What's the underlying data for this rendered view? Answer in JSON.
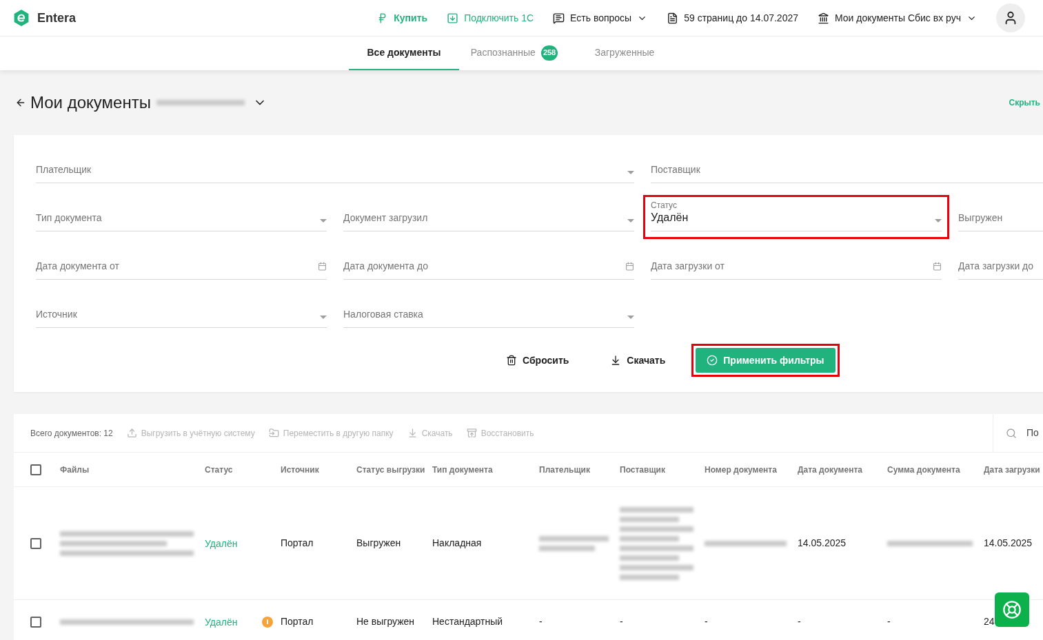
{
  "header": {
    "logo": "Entera",
    "nav": [
      {
        "label": "Купить",
        "kind": "buy",
        "accent": true,
        "dropdown": false
      },
      {
        "label": "Подключить 1С",
        "kind": "connect",
        "accent": true,
        "dropdown": false
      },
      {
        "label": "Есть вопросы",
        "kind": "help",
        "accent": false,
        "dropdown": true
      },
      {
        "label": "59 страниц до 14.07.2027",
        "kind": "pages",
        "accent": false,
        "dropdown": false
      },
      {
        "label": "Мои документы Сбис вх руч",
        "kind": "org",
        "accent": false,
        "dropdown": true
      }
    ]
  },
  "tabs": [
    {
      "label": "Все документы",
      "selected": true
    },
    {
      "label": "Распознанные",
      "selected": false,
      "badge": "258"
    },
    {
      "label": "Загруженные",
      "selected": false
    }
  ],
  "page": {
    "title": "Мои документы",
    "hide_link": "Скрыть"
  },
  "filters": {
    "rows": [
      [
        {
          "label": "Плательщик",
          "kind": "select",
          "highlighted": false
        },
        "",
        {
          "label": "Поставщик",
          "kind": "select",
          "highlighted": false
        },
        ""
      ],
      [
        {
          "label": "Тип документа",
          "kind": "select",
          "highlighted": false
        },
        {
          "label": "Документ загрузил",
          "kind": "select",
          "highlighted": false
        },
        {
          "label": "Статус",
          "value": "Удалён",
          "kind": "select",
          "highlighted": true
        },
        {
          "label": "Выгружен",
          "kind": "select",
          "highlighted": false
        }
      ],
      [
        {
          "label": "Дата документа от",
          "kind": "date",
          "highlighted": false
        },
        {
          "label": "Дата документа до",
          "kind": "date",
          "highlighted": false
        },
        {
          "label": "Дата загрузки от",
          "kind": "date",
          "highlighted": false
        },
        {
          "label": "Дата загрузки до",
          "kind": "date",
          "highlighted": false
        }
      ],
      [
        {
          "label": "Источник",
          "kind": "select",
          "highlighted": false
        },
        {
          "label": "Налоговая ставка",
          "kind": "select",
          "highlighted": false
        }
      ]
    ],
    "buttons": [
      {
        "label": "Сбросить",
        "kind": "reset",
        "highlighted": false
      },
      {
        "label": "Скачать",
        "kind": "download",
        "highlighted": false
      },
      {
        "label": "Применить фильтры",
        "kind": "apply",
        "highlighted": true
      }
    ]
  },
  "table": {
    "total": "Всего документов: 12",
    "actions": [
      {
        "label": "Выгрузить в учётную систему",
        "kind": "upload",
        "disabled": true
      },
      {
        "label": "Переместить в другую папку",
        "kind": "move",
        "disabled": true
      },
      {
        "label": "Скачать",
        "kind": "download",
        "disabled": true
      },
      {
        "label": "Восстановить",
        "kind": "restore",
        "disabled": true
      }
    ],
    "search": {
      "placeholder": "По"
    },
    "select_all": {
      "checked": false
    },
    "columns": [
      "Файлы",
      "Статус",
      "Источник",
      "Статус выгрузки",
      "Тип документа",
      "Плательщик",
      "Поставщик",
      "Номер документа",
      "Дата документа",
      "Сумма документа",
      "Дата загрузки"
    ],
    "rows": [
      {
        "checked": false,
        "cells": [
          {
            "kind": "redacted"
          },
          {
            "kind": "status",
            "text": "Удалён"
          },
          {
            "kind": "text",
            "text": "Портал",
            "warning": false
          },
          {
            "kind": "text",
            "text": "Выгружен"
          },
          {
            "kind": "text",
            "text": "Накладная"
          },
          {
            "kind": "redacted"
          },
          {
            "kind": "redacted"
          },
          {
            "kind": "redacted"
          },
          {
            "kind": "text",
            "text": "14.05.2025"
          },
          {
            "kind": "redacted"
          },
          {
            "kind": "text",
            "text": "14.05.2025"
          }
        ]
      },
      {
        "checked": false,
        "cells": [
          {
            "kind": "redacted"
          },
          {
            "kind": "status",
            "text": "Удалён"
          },
          {
            "kind": "text",
            "text": "Портал",
            "warning": true
          },
          {
            "kind": "text",
            "text": "Не выгружен"
          },
          {
            "kind": "text",
            "text": "Нестандартный"
          },
          {
            "kind": "text",
            "text": "-"
          },
          {
            "kind": "text",
            "text": "-"
          },
          {
            "kind": "text",
            "text": "-"
          },
          {
            "kind": "text",
            "text": "-"
          },
          {
            "kind": "text",
            "text": "-"
          },
          {
            "kind": "text",
            "text": "24"
          }
        ]
      }
    ]
  }
}
